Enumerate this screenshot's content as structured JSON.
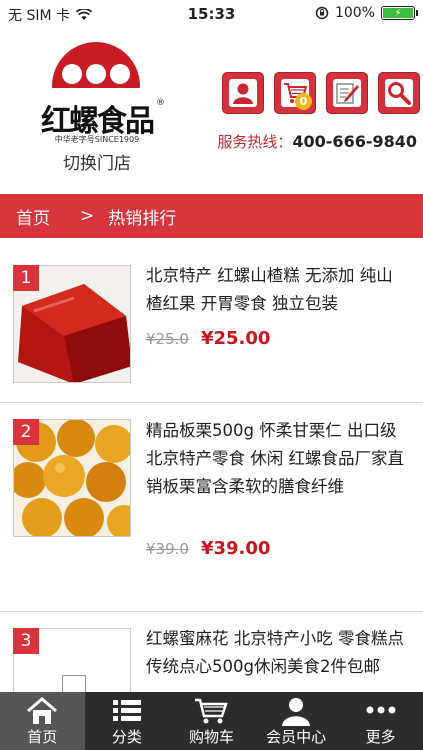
{
  "status": {
    "carrier": "无 SIM 卡",
    "time": "15:33",
    "battery": "100%"
  },
  "header": {
    "logo_name": "红螺食品",
    "logo_reg": "®",
    "logo_since": "中华老字号SINCE1909",
    "switch_store": "切换门店",
    "cart_count": "0",
    "hotline_label": "服务热线：",
    "hotline_number": "400-666-9840",
    "icons": [
      "user-icon",
      "cart-icon",
      "edit-icon",
      "search-icon"
    ]
  },
  "breadcrumb": {
    "home": "首页",
    "separator": ">",
    "current": "热销排行"
  },
  "products": [
    {
      "rank": "1",
      "title": "北京特产 红螺山楂糕 无添加 纯山楂红果 开胃零食 独立包装",
      "old_price": "¥25.0",
      "price": "¥25.00"
    },
    {
      "rank": "2",
      "title": "精品板栗500g 怀柔甘栗仁 出口级 北京特产零食 休闲 红螺食品厂家直销板栗富含柔软的膳食纤维",
      "old_price": "¥39.0",
      "price": "¥39.00"
    },
    {
      "rank": "3",
      "title": "红螺蜜麻花 北京特产小吃 零食糕点 传统点心500g休闲美食2件包邮",
      "old_price": "",
      "price": ""
    }
  ],
  "tabbar": [
    {
      "label": "首页",
      "icon": "home-icon"
    },
    {
      "label": "分类",
      "icon": "list-icon"
    },
    {
      "label": "购物车",
      "icon": "cart-icon"
    },
    {
      "label": "会员中心",
      "icon": "member-icon"
    },
    {
      "label": "更多",
      "icon": "more-icon"
    }
  ],
  "colors": {
    "brand_red": "#d8343b",
    "price_red": "#c9161e",
    "tabbar": "#2c2c2c"
  }
}
